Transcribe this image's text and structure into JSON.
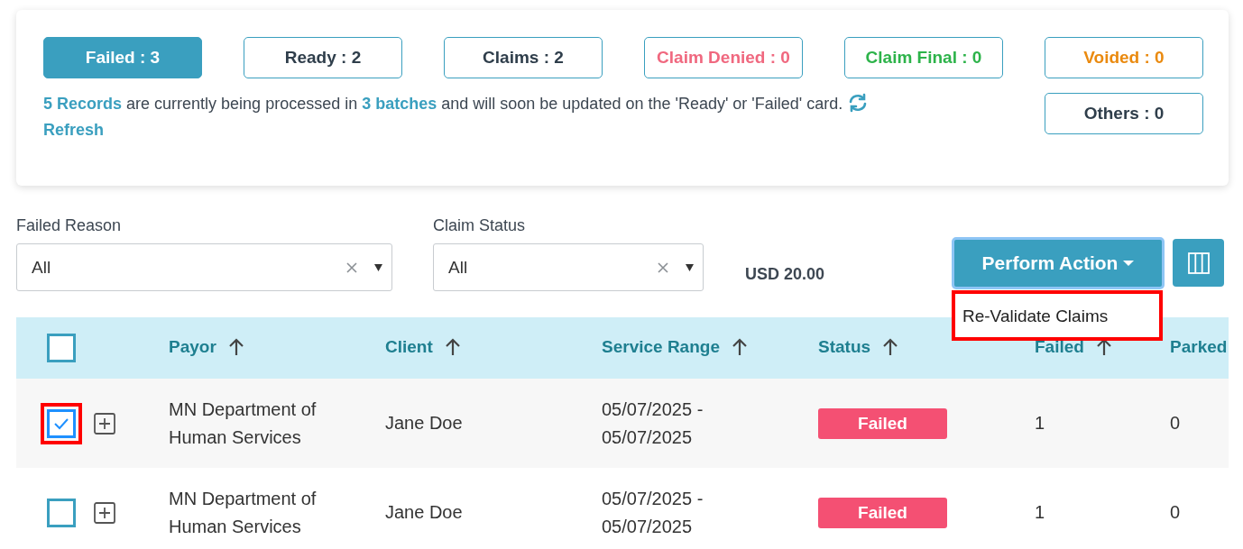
{
  "status_cards": [
    {
      "label": "Failed : 3",
      "selected": true,
      "color": "#ffffff"
    },
    {
      "label": "Ready : 2",
      "selected": false,
      "color": "#2f3e4b"
    },
    {
      "label": "Claims : 2",
      "selected": false,
      "color": "#2f3e4b"
    },
    {
      "label": "Claim Denied : 0",
      "selected": false,
      "color": "#f0687f"
    },
    {
      "label": "Claim Final : 0",
      "selected": false,
      "color": "#2db34a"
    },
    {
      "label": "Voided : 0",
      "selected": false,
      "color": "#ea8a0f"
    },
    {
      "label": "Others : 0",
      "selected": false,
      "color": "#2f3e4b"
    }
  ],
  "processing_message": {
    "text": "**5 Records** are currently being processed in **3 batches** and will soon be updated on the 'Ready' or 'Failed' card.",
    "refresh_link": "Refresh"
  },
  "filters": [
    {
      "label": "Failed Reason",
      "value": "All"
    },
    {
      "label": "Claim Status",
      "value": "All"
    }
  ],
  "total_amount": "USD 20.00",
  "perform_action": {
    "label": "Perform Action",
    "expanded": true,
    "menu": [
      {
        "label": "Re-Validate Claims",
        "highlighted": true
      }
    ]
  },
  "table": {
    "all_checked": false,
    "columns": [
      "Payor",
      "Client",
      "Service Range",
      "Status",
      "Failed",
      "Parked"
    ],
    "rows": [
      {
        "checked": true,
        "highlighted": true,
        "payor": "MN Department of Human Services",
        "client": "Jane Doe",
        "service_range": "05/07/2025 - 05/07/2025",
        "status": "Failed",
        "failed": "1",
        "parked": "0"
      },
      {
        "checked": false,
        "highlighted": false,
        "payor": "MN Department of Human Services",
        "client": "Jane Doe",
        "service_range": "05/07/2025 - 05/07/2025",
        "status": "Failed",
        "failed": "1",
        "parked": "0"
      }
    ]
  }
}
